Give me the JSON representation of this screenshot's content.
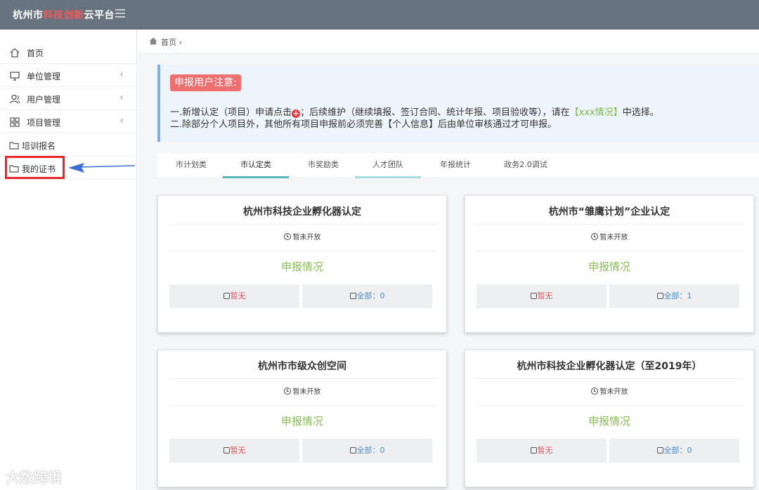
{
  "header": {
    "title_part1": "杭州市",
    "title_accent": "科技创新",
    "title_part2": "云平台"
  },
  "sidebar": {
    "items": [
      {
        "label": "首页"
      },
      {
        "label": "单位管理"
      },
      {
        "label": "用户管理"
      },
      {
        "label": "项目管理"
      },
      {
        "label": "培训报名"
      },
      {
        "label": "我的证书"
      }
    ],
    "chevron": "‹"
  },
  "breadcrumb": {
    "label": "首页 ›"
  },
  "notice": {
    "title": "申报用户注意:",
    "line1_a": "一.新增认定（项目）申请点击",
    "line1_b": "；后续维护（继续填报、签订合同、统计年报、项目验收等），请在",
    "line1_link": "【xxx情况】",
    "line1_c": "中选择。",
    "line2": "二.除部分个人项目外，其他所有项目申报前必须完善【个人信息】后由单位审核通过才可申报。"
  },
  "tabs": [
    {
      "label": "市计划类"
    },
    {
      "label": "市认定类"
    },
    {
      "label": "市奖励类"
    },
    {
      "label": "人才团队"
    },
    {
      "label": "年报统计"
    },
    {
      "label": "政务2.0调试"
    }
  ],
  "cards": [
    {
      "title": "杭州市科技企业孵化器认定",
      "status": "暂未开放",
      "report": "申报情况",
      "left": "暂无",
      "right": "全部：0"
    },
    {
      "title": "杭州市“雏鹰计划”企业认定",
      "status": "暂未开放",
      "report": "申报情况",
      "left": "暂无",
      "right": "全部：1"
    },
    {
      "title": "杭州市市级众创空间",
      "status": "暂未开放",
      "report": "申报情况",
      "left": "暂无",
      "right": "全部：0"
    },
    {
      "title": "杭州市科技企业孵化器认定（至2019年）",
      "status": "暂未开放",
      "report": "申报情况",
      "left": "暂无",
      "right": "全部：0"
    }
  ],
  "watermark": "大数跨境",
  "colors": {
    "topbar": "#687380",
    "accent_red": "#f05a5a",
    "highlight": "#e8262b",
    "arrow": "#3b6fd6",
    "tab_active": "#56b3b8",
    "report_green": "#8bbd5a",
    "link_blue": "#4a8ccf"
  }
}
